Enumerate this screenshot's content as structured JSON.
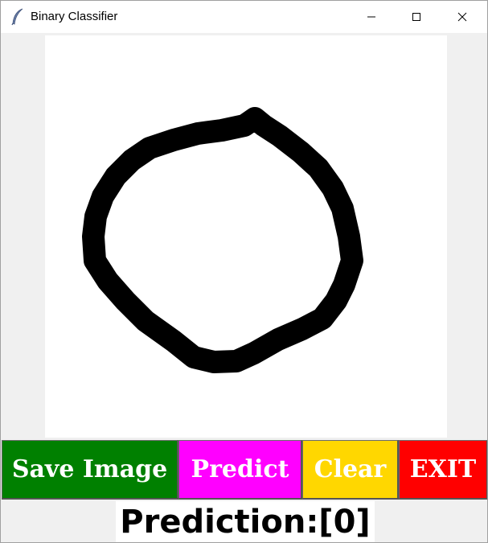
{
  "window": {
    "title": "Binary Classifier",
    "icon": "feather-icon",
    "controls": [
      "minimize-icon",
      "maximize-icon",
      "close-icon"
    ]
  },
  "canvas": {
    "background": "#ffffff",
    "stroke_color": "#000000",
    "drawing": "circle"
  },
  "buttons": {
    "save": {
      "label": "Save Image",
      "color": "#008000"
    },
    "predict": {
      "label": "Predict",
      "color": "#ff00ff"
    },
    "clear": {
      "label": "Clear",
      "color": "#ffd700"
    },
    "exit": {
      "label": "EXIT",
      "color": "#ff0000"
    }
  },
  "result": {
    "text": "Prediction:[0]"
  }
}
